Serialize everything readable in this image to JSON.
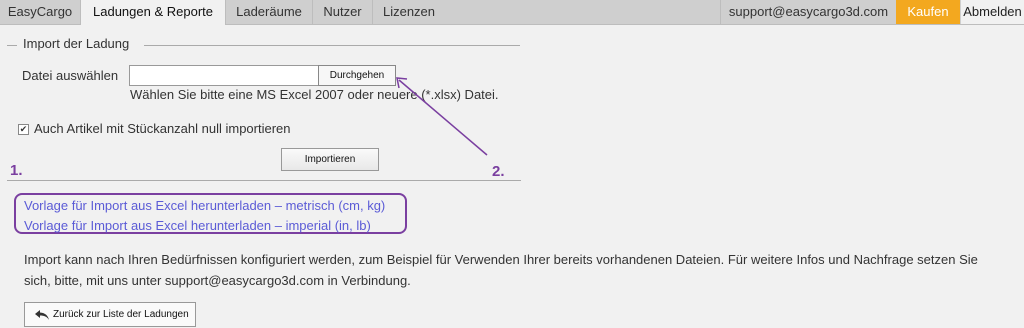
{
  "nav": {
    "tabs": [
      {
        "label": "EasyCargo"
      },
      {
        "label": "Ladungen & Reporte"
      },
      {
        "label": "Laderäume"
      },
      {
        "label": "Nutzer"
      },
      {
        "label": "Lizenzen"
      }
    ],
    "account_email": "support@easycargo3d.com",
    "buy_label": "Kaufen",
    "logout_label": "Abmelden"
  },
  "import": {
    "legend": "Import der Ladung",
    "file_label": "Datei auswählen",
    "file_value": "",
    "browse_label": "Durchgehen",
    "hint": "Wählen Sie bitte eine MS Excel 2007 oder neuere (*.xlsx) Datei.",
    "zero_qty_checked": true,
    "zero_qty_label": "Auch Artikel mit Stückanzahl null importieren",
    "import_button": "Importieren"
  },
  "annotations": {
    "step1": "1.",
    "step2": "2.",
    "accent_color": "#7a3fa0"
  },
  "templates": {
    "metric": "Vorlage für Import aus Excel herunterladen – metrisch (cm, kg)",
    "imperial": "Vorlage für Import aus Excel herunterladen – imperial (in, lb)"
  },
  "info_text": "Import kann nach Ihren Bedürfnissen konfiguriert werden, zum Beispiel für Verwenden Ihrer bereits vorhandenen Dateien. Für weitere Infos und Nachfrage setzen Sie sich, bitte, mit uns unter support@easycargo3d.com in Verbindung.",
  "back_button": {
    "label": "Zurück zur Liste der Ladungen",
    "icon": "back-arrow-icon"
  },
  "colors": {
    "buy": "#f3a81f",
    "link": "#5b5bd6"
  }
}
